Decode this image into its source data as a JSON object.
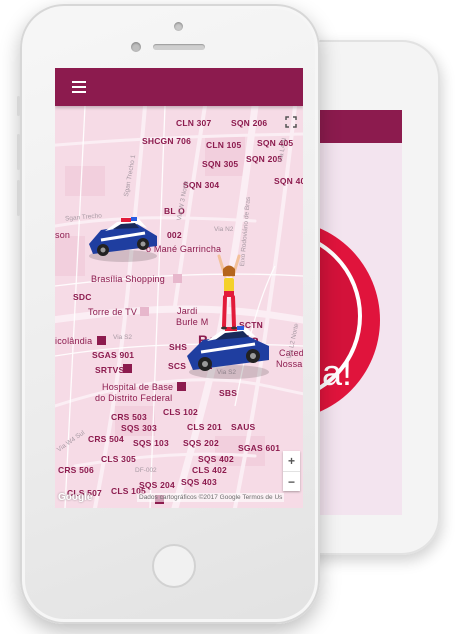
{
  "colors": {
    "brand": "#8c1b4e",
    "map_background": "#f6dbe6",
    "alert_red": "#e0143c"
  },
  "back_screen": {
    "alert_text": "a!"
  },
  "map": {
    "city_label": "Brasília",
    "places": [
      {
        "id": "cln307",
        "text": "CLN 307"
      },
      {
        "id": "sqn206",
        "text": "SQN 206"
      },
      {
        "id": "shcgn706",
        "text": "SHCGN 706"
      },
      {
        "id": "cln105",
        "text": "CLN 105"
      },
      {
        "id": "sqn405",
        "text": "SQN 405"
      },
      {
        "id": "sqn305",
        "text": "SQN 305"
      },
      {
        "id": "sqn205",
        "text": "SQN 205"
      },
      {
        "id": "sqn304",
        "text": "SQN 304"
      },
      {
        "id": "sqn40",
        "text": "SQN 40"
      },
      {
        "id": "bl0",
        "text": "BL O"
      },
      {
        "id": "son",
        "text": "son"
      },
      {
        "id": "d02",
        "text": "002"
      },
      {
        "id": "garrincha",
        "text": "o Mané Garrincha"
      },
      {
        "id": "shopping",
        "text": "Brasília Shopping"
      },
      {
        "id": "sdc",
        "text": "SDC"
      },
      {
        "id": "torre",
        "text": "Torre de TV"
      },
      {
        "id": "jardim",
        "text": "Jardi"
      },
      {
        "id": "burle",
        "text": "Burle M"
      },
      {
        "id": "sctn",
        "text": "SCTN"
      },
      {
        "id": "icolandia",
        "text": "icolândia"
      },
      {
        "id": "shs",
        "text": "SHS"
      },
      {
        "id": "catedral",
        "text": "Cated"
      },
      {
        "id": "nossa",
        "text": "Nossa"
      },
      {
        "id": "sgas901",
        "text": "SGAS 901"
      },
      {
        "id": "scs",
        "text": "SCS"
      },
      {
        "id": "srtvs",
        "text": "SRTVS"
      },
      {
        "id": "hospital1",
        "text": "Hospital de Base"
      },
      {
        "id": "hospital2",
        "text": "do Distrito Federal"
      },
      {
        "id": "sbs",
        "text": "SBS"
      },
      {
        "id": "crs503",
        "text": "CRS 503"
      },
      {
        "id": "cls102",
        "text": "CLS 102"
      },
      {
        "id": "sqs303",
        "text": "SQS 303"
      },
      {
        "id": "cls201",
        "text": "CLS 201"
      },
      {
        "id": "saus",
        "text": "SAUS"
      },
      {
        "id": "crs504",
        "text": "CRS 504"
      },
      {
        "id": "sqs103",
        "text": "SQS 103"
      },
      {
        "id": "sqs202",
        "text": "SQS 202"
      },
      {
        "id": "sgas601",
        "text": "SGAS 601"
      },
      {
        "id": "cls305",
        "text": "CLS 305"
      },
      {
        "id": "sqs402",
        "text": "SQS 402"
      },
      {
        "id": "crs506",
        "text": "CRS 506"
      },
      {
        "id": "cls402",
        "text": "CLS 402"
      },
      {
        "id": "sqs204",
        "text": "SQS 204"
      },
      {
        "id": "cls507",
        "text": "CLS 507"
      },
      {
        "id": "sqs403",
        "text": "SQS 403"
      },
      {
        "id": "cls105",
        "text": "CLS 105"
      }
    ],
    "streets": [
      {
        "id": "via_n2",
        "text": "Via N2"
      },
      {
        "id": "via_s2",
        "text": "Via S2"
      },
      {
        "id": "via_w3_norte",
        "text": "Via W 3 Norte"
      },
      {
        "id": "eixo",
        "text": "Eixo Rodoviário de Bras"
      },
      {
        "id": "via_l2_norte",
        "text": "Via L2 Norte"
      },
      {
        "id": "via_l4",
        "text": "Via L4 N"
      },
      {
        "id": "sgan",
        "text": "Sgan Trecho"
      },
      {
        "id": "df002",
        "text": "DF-002"
      },
      {
        "id": "via_w4_sul",
        "text": "Via W4 Sul"
      },
      {
        "id": "via_s2b",
        "text": "Via S2"
      },
      {
        "id": "trecho",
        "text": "Sgan Trecho 1"
      }
    ],
    "attribution": "Dados cartográficos ©2017 Google  Termos de Us",
    "google_logo": "Google",
    "zoom_in": "+",
    "zoom_out": "−"
  }
}
